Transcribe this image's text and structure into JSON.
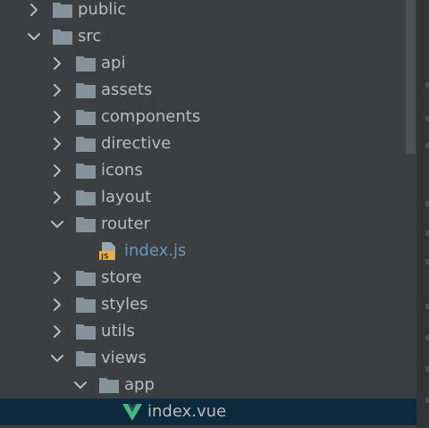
{
  "tree": {
    "items": [
      {
        "label": "public",
        "type": "folder",
        "depth": 0,
        "expanded": false
      },
      {
        "label": "src",
        "type": "folder",
        "depth": 0,
        "expanded": true
      },
      {
        "label": "api",
        "type": "folder",
        "depth": 1,
        "expanded": false
      },
      {
        "label": "assets",
        "type": "folder",
        "depth": 1,
        "expanded": false
      },
      {
        "label": "components",
        "type": "folder",
        "depth": 1,
        "expanded": false
      },
      {
        "label": "directive",
        "type": "folder",
        "depth": 1,
        "expanded": false
      },
      {
        "label": "icons",
        "type": "folder",
        "depth": 1,
        "expanded": false
      },
      {
        "label": "layout",
        "type": "folder",
        "depth": 1,
        "expanded": false
      },
      {
        "label": "router",
        "type": "folder",
        "depth": 1,
        "expanded": true
      },
      {
        "label": "index.js",
        "type": "js-file",
        "depth": 2,
        "expanded": null
      },
      {
        "label": "store",
        "type": "folder",
        "depth": 1,
        "expanded": false
      },
      {
        "label": "styles",
        "type": "folder",
        "depth": 1,
        "expanded": false
      },
      {
        "label": "utils",
        "type": "folder",
        "depth": 1,
        "expanded": false
      },
      {
        "label": "views",
        "type": "folder",
        "depth": 1,
        "expanded": true
      },
      {
        "label": "app",
        "type": "folder",
        "depth": 2,
        "expanded": true
      },
      {
        "label": "index.vue",
        "type": "vue-file",
        "depth": 3,
        "expanded": null,
        "selected": true
      }
    ]
  },
  "icons": {
    "js_badge": "JS"
  },
  "colors": {
    "background": "#3c3f41",
    "text": "#bbbbbb",
    "js_file_text": "#6897bb",
    "selection": "#0d293e",
    "folder": "#87939a",
    "vue_green": "#41b883"
  }
}
